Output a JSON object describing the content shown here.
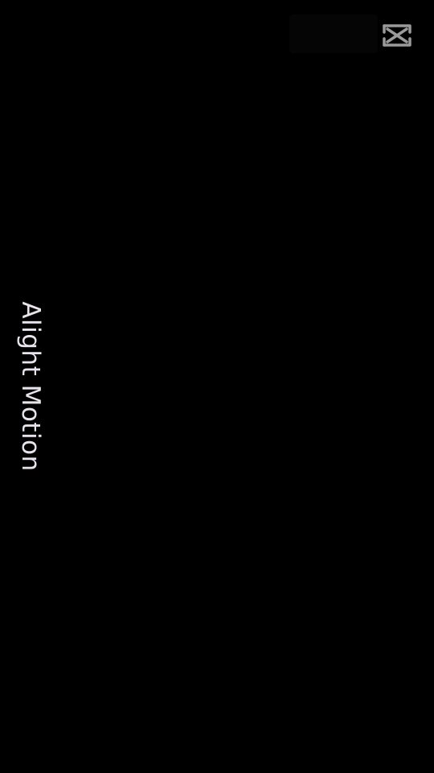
{
  "watermark": {
    "text": "Alight Motion"
  },
  "logo": {
    "icon": "capcut-logo-icon",
    "color": "#9a9a9a"
  },
  "colors": {
    "background": "#000000",
    "watermark_text": "#e9e3ee"
  }
}
